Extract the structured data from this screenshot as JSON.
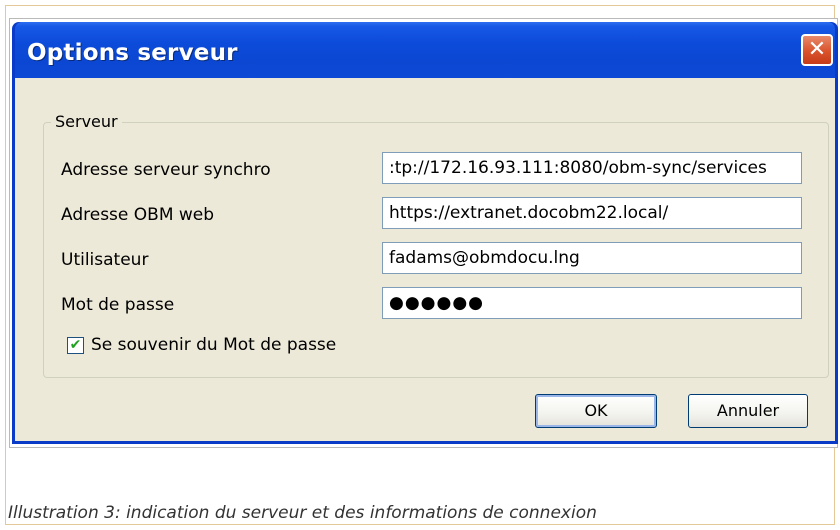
{
  "window": {
    "title": "Options serveur",
    "close_glyph": "✕",
    "colors": {
      "titlebar": "#0b47d2",
      "close_button": "#d9532b",
      "client": "#ece9d8"
    }
  },
  "group": {
    "title": "Serveur",
    "fields": [
      {
        "label": "Adresse serveur synchro",
        "value": ":tp://172.16.93.111:8080/obm-sync/services"
      },
      {
        "label": "Adresse OBM web",
        "value": "https://extranet.docobm22.local/"
      },
      {
        "label": "Utilisateur",
        "value": "fadams@obmdocu.lng"
      },
      {
        "label": "Mot de passe",
        "value": "●●●●●●"
      }
    ],
    "remember": {
      "label": "Se souvenir du Mot de passe",
      "checked": true,
      "glyph": "✔"
    }
  },
  "buttons": {
    "ok": "OK",
    "cancel": "Annuler"
  },
  "caption": "Illustration 3: indication du serveur et des informations de connexion"
}
